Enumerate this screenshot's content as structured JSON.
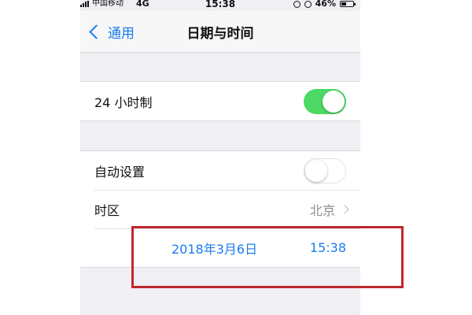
{
  "status_bar": {
    "carrier": "中国移动",
    "network": "4G",
    "time": "15:38",
    "battery": "46%",
    "battery_level": 0.46
  },
  "nav": {
    "back_label": "通用",
    "title": "日期与时间"
  },
  "settings": {
    "hour24": {
      "label": "24 小时制",
      "enabled": true
    },
    "auto_set": {
      "label": "自动设置",
      "enabled": false
    },
    "timezone": {
      "label": "时区",
      "value": "北京"
    },
    "date": "2018年3月6日",
    "time": "15:38"
  },
  "colors": {
    "accent": "#1a7cf0",
    "toggle_on": "#4cd964",
    "annotation_box": "#c0272d"
  }
}
